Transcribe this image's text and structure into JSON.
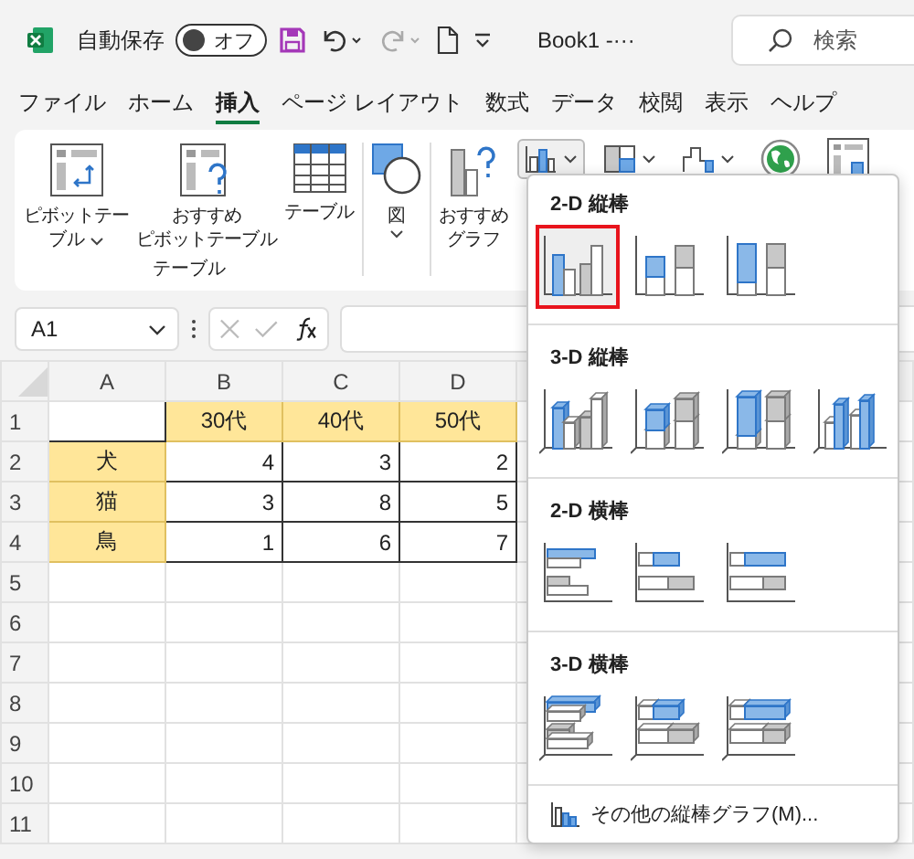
{
  "title_bar": {
    "autosave_label": "自動保存",
    "autosave_toggle": {
      "label": "オフ",
      "on": false
    },
    "filename": "Book1 -···",
    "search": {
      "placeholder": "検索"
    }
  },
  "menu_tabs": [
    {
      "label": "ファイル",
      "selected": false
    },
    {
      "label": "ホーム",
      "selected": false
    },
    {
      "label": "挿入",
      "selected": true
    },
    {
      "label": "ページ レイアウト",
      "selected": false
    },
    {
      "label": "数式",
      "selected": false
    },
    {
      "label": "データ",
      "selected": false
    },
    {
      "label": "校閲",
      "selected": false
    },
    {
      "label": "表示",
      "selected": false
    },
    {
      "label": "ヘルプ",
      "selected": false
    }
  ],
  "ribbon": {
    "groups": [
      {
        "label": "テーブル",
        "buttons": [
          {
            "kind": "pivot",
            "lines": [
              "ピボットテー",
              "ブル"
            ],
            "dropdown": true
          },
          {
            "kind": "recommended_pivot",
            "lines": [
              "おすすめ",
              "ピボットテーブル"
            ]
          },
          {
            "kind": "table",
            "lines": [
              "テーブル"
            ]
          }
        ]
      },
      {
        "buttons": [
          {
            "kind": "illustrations",
            "lines": [
              "図"
            ],
            "dropdown": true
          }
        ]
      },
      {
        "buttons": [
          {
            "kind": "recommended_chart",
            "lines": [
              "おすすめ",
              "グラフ"
            ]
          }
        ],
        "small_buttons": [
          {
            "kind": "column",
            "open": true,
            "dropdown": true
          },
          {
            "kind": "hierarchy",
            "open": false,
            "dropdown": true
          },
          {
            "kind": "waterfall",
            "open": false,
            "dropdown": true
          },
          {
            "kind": "map",
            "open": false,
            "dropdown": false
          },
          {
            "kind": "pivot_chart",
            "open": false,
            "dropdown": false
          }
        ]
      }
    ]
  },
  "formula_bar": {
    "name_box": "A1"
  },
  "sheet": {
    "columns": [
      "A",
      "B",
      "C",
      "D"
    ],
    "rows": [
      {
        "header": "1",
        "cells": [
          {
            "fill": false
          },
          {
            "text": "30代",
            "fill": true,
            "kind": "label"
          },
          {
            "text": "40代",
            "fill": true,
            "kind": "label"
          },
          {
            "text": "50代",
            "fill": true,
            "kind": "label"
          }
        ]
      },
      {
        "header": "2",
        "cells": [
          {
            "text": "犬",
            "fill": true,
            "kind": "label"
          },
          {
            "text": "4",
            "fill": false,
            "kind": "number"
          },
          {
            "text": "3",
            "fill": false,
            "kind": "number"
          },
          {
            "text": "2",
            "fill": false,
            "kind": "number"
          }
        ]
      },
      {
        "header": "3",
        "cells": [
          {
            "text": "猫",
            "fill": true,
            "kind": "label"
          },
          {
            "text": "3",
            "fill": false,
            "kind": "number"
          },
          {
            "text": "8",
            "fill": false,
            "kind": "number"
          },
          {
            "text": "5",
            "fill": false,
            "kind": "number"
          }
        ]
      },
      {
        "header": "4",
        "cells": [
          {
            "text": "鳥",
            "fill": true,
            "kind": "label"
          },
          {
            "text": "1",
            "fill": false,
            "kind": "number"
          },
          {
            "text": "6",
            "fill": false,
            "kind": "number"
          },
          {
            "text": "7",
            "fill": false,
            "kind": "number"
          }
        ]
      },
      {
        "header": "5"
      },
      {
        "header": "6"
      },
      {
        "header": "7"
      },
      {
        "header": "8"
      },
      {
        "header": "9"
      },
      {
        "header": "10"
      },
      {
        "header": "11"
      }
    ]
  },
  "chart_menu": {
    "sections": [
      {
        "title": "2-D 縦棒",
        "kind": "column_2d",
        "items": [
          {
            "kind": "clustered",
            "selected": true
          },
          {
            "kind": "stacked",
            "selected": false
          },
          {
            "kind": "percent",
            "selected": false
          }
        ]
      },
      {
        "title": "3-D 縦棒",
        "kind": "column_3d",
        "items": [
          {
            "kind": "clustered",
            "selected": false
          },
          {
            "kind": "stacked",
            "selected": false
          },
          {
            "kind": "percent",
            "selected": false
          },
          {
            "kind": "series",
            "selected": false
          }
        ]
      },
      {
        "title": "2-D 横棒",
        "kind": "bar_2d",
        "items": [
          {
            "kind": "clustered",
            "selected": false
          },
          {
            "kind": "stacked",
            "selected": false
          },
          {
            "kind": "percent",
            "selected": false
          }
        ]
      },
      {
        "title": "3-D 横棒",
        "kind": "bar_3d",
        "items": [
          {
            "kind": "clustered",
            "selected": false
          },
          {
            "kind": "stacked",
            "selected": false
          },
          {
            "kind": "percent",
            "selected": false
          }
        ]
      }
    ],
    "more_link": "その他の縦棒グラフ(M)..."
  }
}
